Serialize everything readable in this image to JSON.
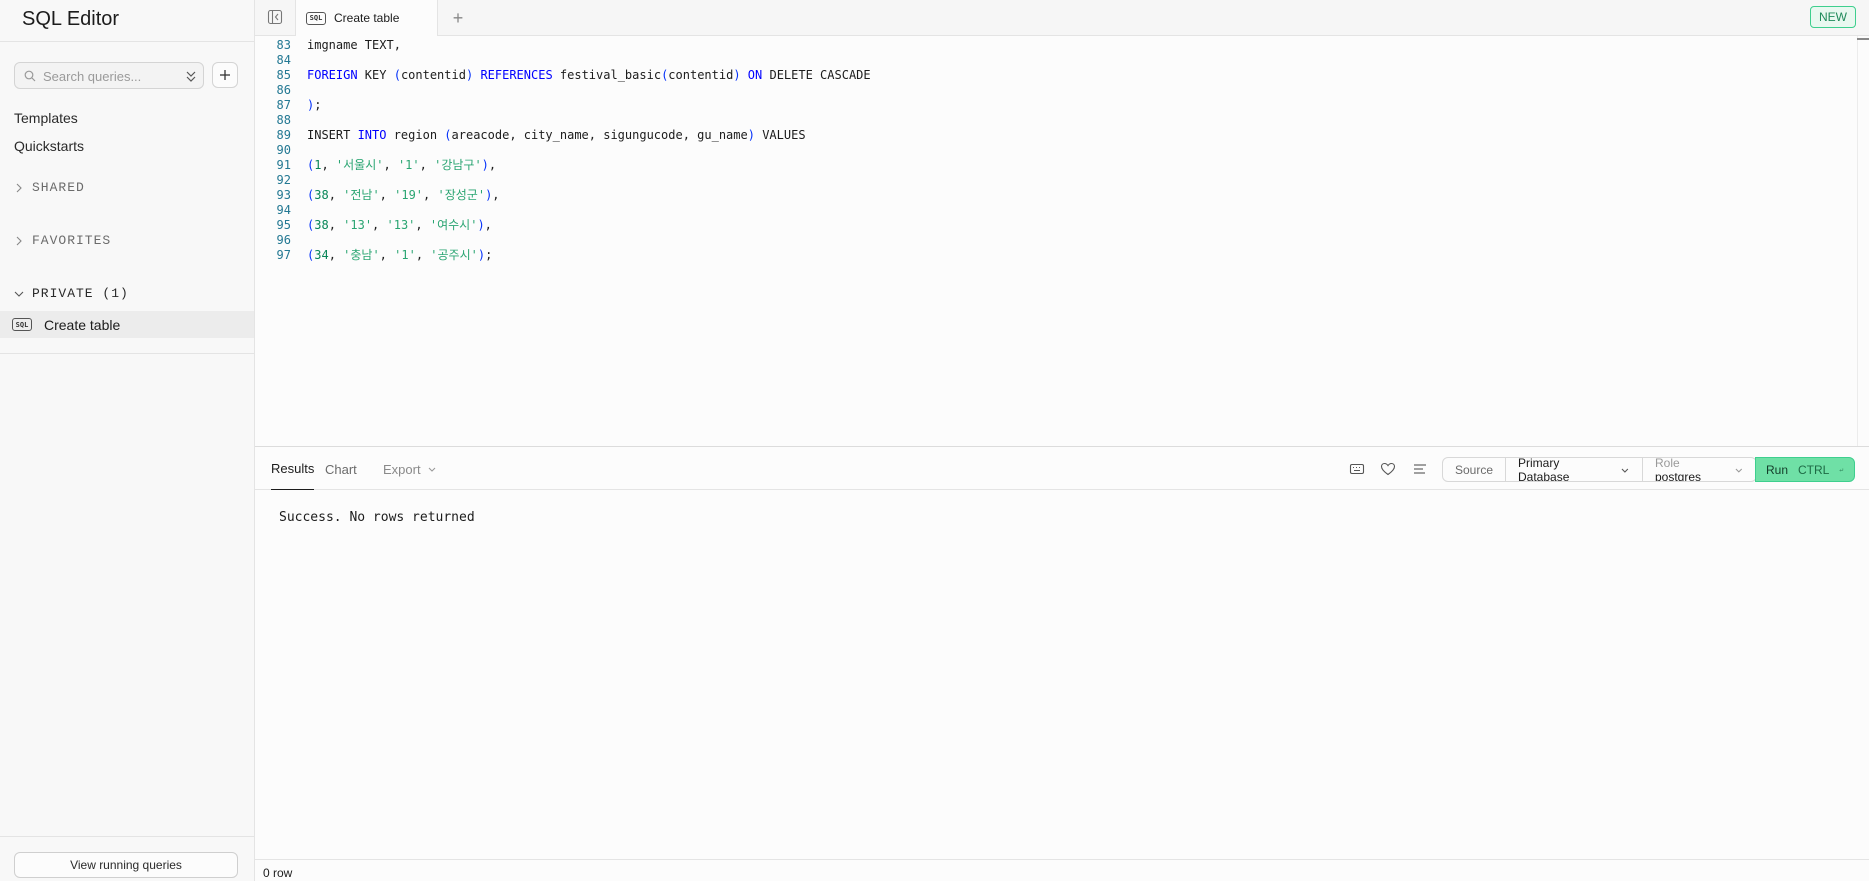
{
  "sidebar": {
    "title": "SQL Editor",
    "search": {
      "placeholder": "Search queries...",
      "value": ""
    },
    "links": [
      "Templates",
      "Quickstarts"
    ],
    "sections": {
      "shared": "SHARED",
      "favorites": "FAVORITES",
      "private": "PRIVATE (1)"
    },
    "private_items": [
      {
        "label": "Create table",
        "badge": "SQL"
      }
    ],
    "view_running_label": "View running queries"
  },
  "tabbar": {
    "active_tab": {
      "label": "Create table",
      "badge": "SQL"
    },
    "add_symbol": "+",
    "new_badge": "NEW"
  },
  "editor": {
    "lines": [
      {
        "n": "83",
        "tokens": [
          [
            "t",
            "imgname TEXT,"
          ]
        ]
      },
      {
        "n": "84",
        "tokens": []
      },
      {
        "n": "85",
        "tokens": [
          [
            "kw",
            "FOREIGN"
          ],
          [
            "t",
            " KEY "
          ],
          [
            "p",
            "("
          ],
          [
            "t",
            "contentid"
          ],
          [
            "p",
            ")"
          ],
          [
            "t",
            " "
          ],
          [
            "kw",
            "REFERENCES"
          ],
          [
            "t",
            " festival_basic"
          ],
          [
            "p",
            "("
          ],
          [
            "t",
            "contentid"
          ],
          [
            "p",
            ")"
          ],
          [
            "t",
            " "
          ],
          [
            "kw",
            "ON"
          ],
          [
            "t",
            " DELETE CASCADE"
          ]
        ]
      },
      {
        "n": "86",
        "tokens": []
      },
      {
        "n": "87",
        "tokens": [
          [
            "p",
            ")"
          ],
          [
            "t",
            ";"
          ]
        ]
      },
      {
        "n": "88",
        "tokens": []
      },
      {
        "n": "89",
        "tokens": [
          [
            "t",
            "INSERT "
          ],
          [
            "kw",
            "INTO"
          ],
          [
            "t",
            " region "
          ],
          [
            "p",
            "("
          ],
          [
            "t",
            "areacode, city_name, sigungucode, gu_name"
          ],
          [
            "p",
            ")"
          ],
          [
            "t",
            " VALUES"
          ]
        ]
      },
      {
        "n": "90",
        "tokens": []
      },
      {
        "n": "91",
        "tokens": [
          [
            "p",
            "("
          ],
          [
            "num",
            "1"
          ],
          [
            "t",
            ", "
          ],
          [
            "str",
            "'서울시'"
          ],
          [
            "t",
            ", "
          ],
          [
            "str",
            "'1'"
          ],
          [
            "t",
            ", "
          ],
          [
            "str",
            "'강남구'"
          ],
          [
            "p",
            ")"
          ],
          [
            "t",
            ","
          ]
        ]
      },
      {
        "n": "92",
        "tokens": []
      },
      {
        "n": "93",
        "tokens": [
          [
            "p",
            "("
          ],
          [
            "num",
            "38"
          ],
          [
            "t",
            ", "
          ],
          [
            "str",
            "'전남'"
          ],
          [
            "t",
            ", "
          ],
          [
            "str",
            "'19'"
          ],
          [
            "t",
            ", "
          ],
          [
            "str",
            "'장성군'"
          ],
          [
            "p",
            ")"
          ],
          [
            "t",
            ","
          ]
        ]
      },
      {
        "n": "94",
        "tokens": []
      },
      {
        "n": "95",
        "tokens": [
          [
            "p",
            "("
          ],
          [
            "num",
            "38"
          ],
          [
            "t",
            ", "
          ],
          [
            "str",
            "'13'"
          ],
          [
            "t",
            ", "
          ],
          [
            "str",
            "'13'"
          ],
          [
            "t",
            ", "
          ],
          [
            "str",
            "'여수시'"
          ],
          [
            "p",
            ")"
          ],
          [
            "t",
            ","
          ]
        ]
      },
      {
        "n": "96",
        "tokens": []
      },
      {
        "n": "97",
        "tokens": [
          [
            "p",
            "("
          ],
          [
            "num",
            "34"
          ],
          [
            "t",
            ", "
          ],
          [
            "str",
            "'충남'"
          ],
          [
            "t",
            ", "
          ],
          [
            "str",
            "'1'"
          ],
          [
            "t",
            ", "
          ],
          [
            "str",
            "'공주시'"
          ],
          [
            "p",
            ")"
          ],
          [
            "t",
            ";"
          ]
        ]
      }
    ]
  },
  "results": {
    "tabs": [
      "Results",
      "Chart"
    ],
    "export_label": "Export",
    "source_label": "Source",
    "database": "Primary Database",
    "role_label": "Role",
    "role_value": "postgres",
    "run_label": "Run",
    "run_shortcut": "CTRL",
    "message": "Success. No rows returned",
    "row_count": "0 row"
  },
  "colors": {
    "accent": "#3ecf8e",
    "run_bg": "#6fe0a6",
    "keyword": "#0000ff",
    "string": "#2aa572",
    "line_number": "#237893"
  }
}
